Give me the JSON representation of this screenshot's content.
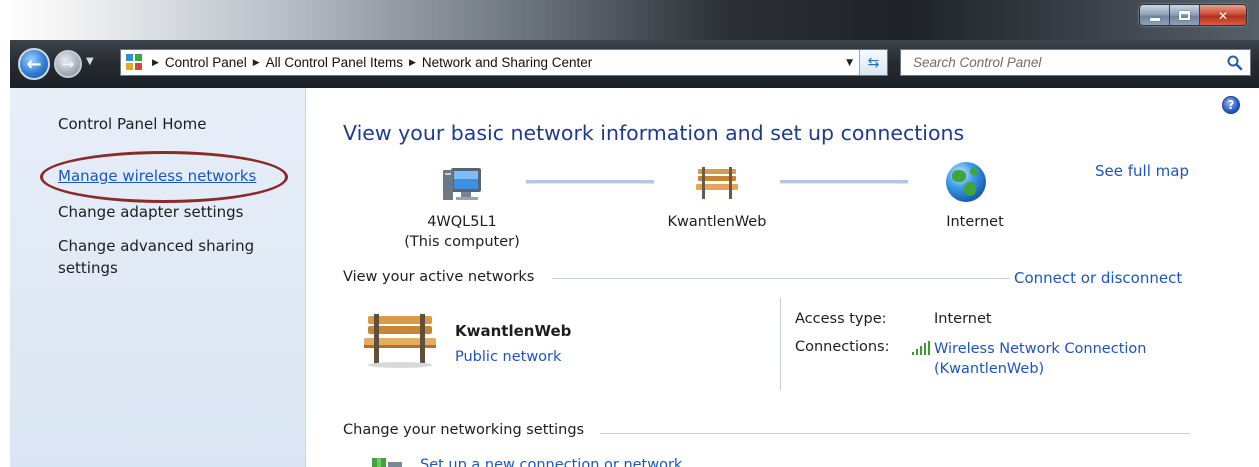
{
  "window": {
    "minimize_icon": "minimize-icon",
    "maximize_icon": "maximize-icon",
    "close_icon": "close-icon"
  },
  "address_bar": {
    "breadcrumbs": [
      {
        "label": "Control Panel"
      },
      {
        "label": "All Control Panel Items"
      },
      {
        "label": "Network and Sharing Center"
      }
    ],
    "separator": "▶"
  },
  "search": {
    "placeholder": "Search Control Panel"
  },
  "sidebar": {
    "items": [
      {
        "label": "Control Panel Home"
      },
      {
        "label": "Manage wireless networks"
      },
      {
        "label": "Change adapter settings"
      },
      {
        "label": "Change advanced sharing settings"
      }
    ]
  },
  "main": {
    "title": "View your basic network information and set up connections",
    "see_full_map": "See full map",
    "map": {
      "computer_name": "4WQL5L1",
      "computer_caption": "(This computer)",
      "network_name": "KwantlenWeb",
      "internet_label": "Internet"
    },
    "active_networks": {
      "section_label": "View your active networks",
      "connect_link": "Connect or disconnect",
      "network_name": "KwantlenWeb",
      "network_type": "Public network",
      "access_type_label": "Access type:",
      "access_type_value": "Internet",
      "connections_label": "Connections:",
      "connection_line1": "Wireless Network Connection",
      "connection_line2": "(KwantlenWeb)"
    },
    "networking_settings": {
      "section_label": "Change your networking settings",
      "setup_link": "Set up a new connection or network"
    }
  },
  "colors": {
    "link": "#1b55c2",
    "title": "#1e3b8f",
    "sidebar_bg": "#e3ebf6",
    "highlight_ellipse": "#8b2a2a"
  }
}
